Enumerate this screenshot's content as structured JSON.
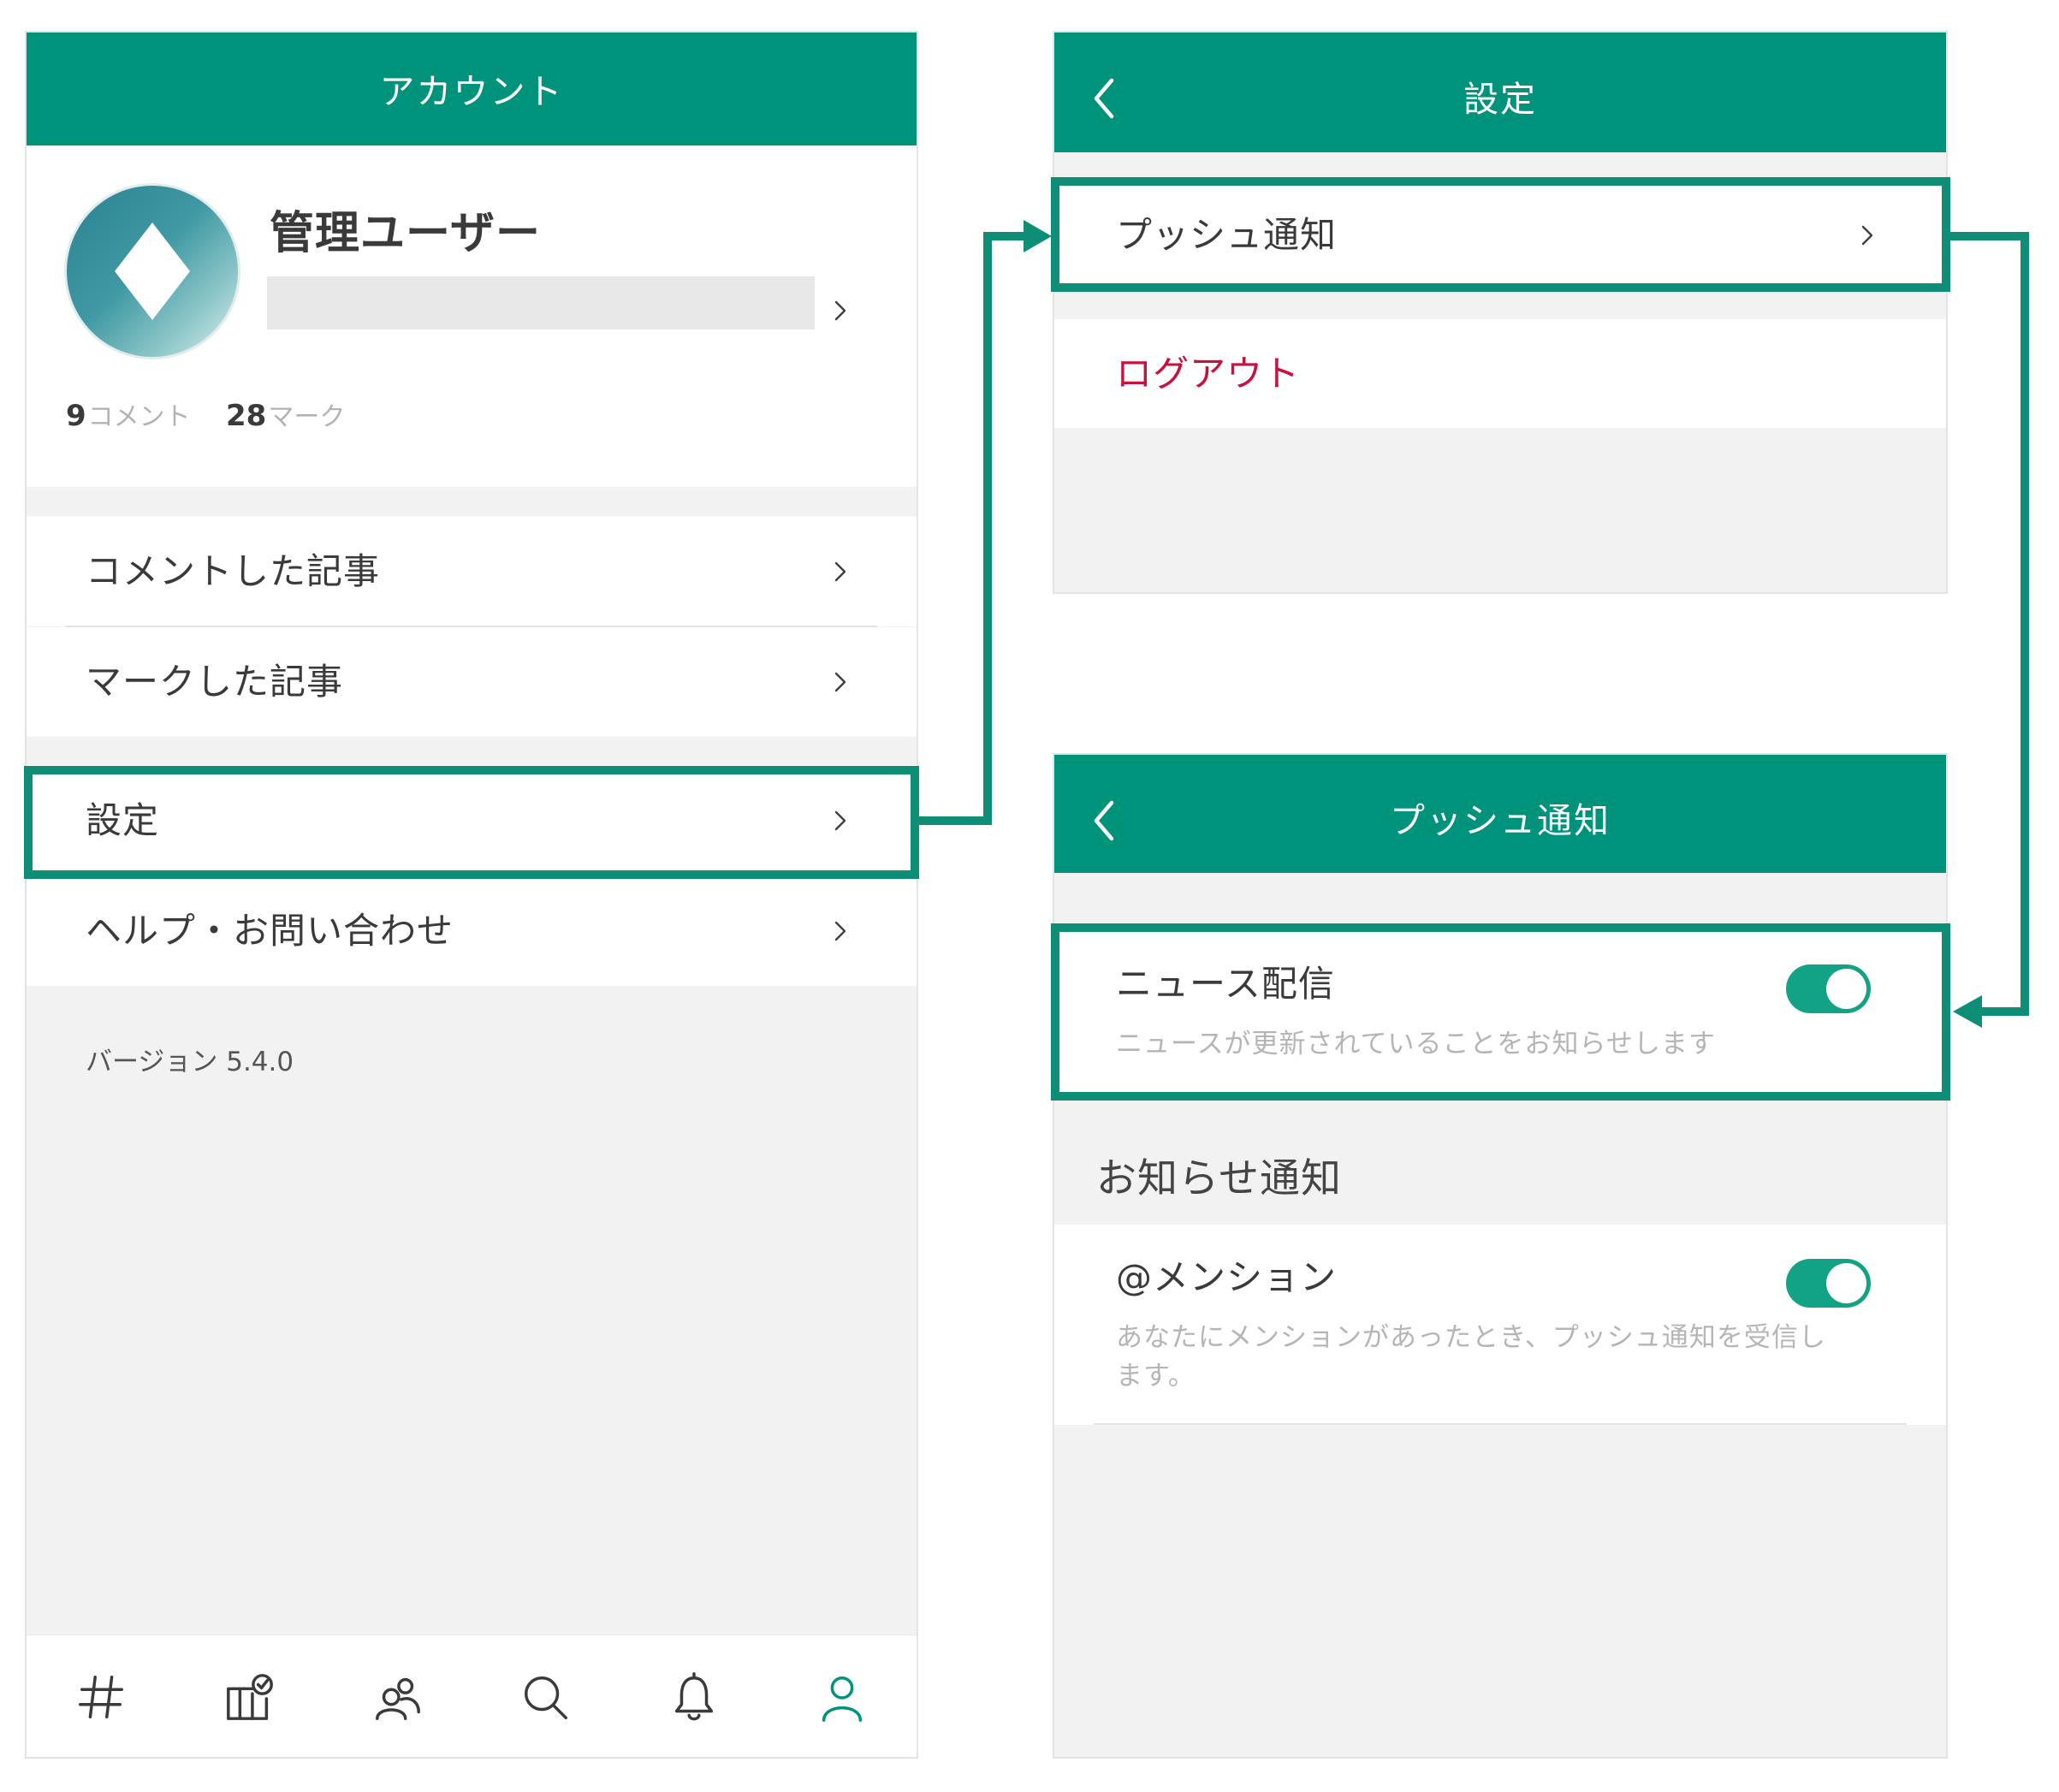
{
  "colors": {
    "brand_green": "#00937c",
    "highlight": "#0e8e77",
    "logout_red": "#c8113f",
    "toggle_on": "#12a386"
  },
  "account_screen": {
    "header": {
      "title": "アカウント"
    },
    "profile": {
      "name": "管理ユーザー",
      "avatar_icon": "diamond-avatar-icon",
      "stats": [
        {
          "count": "9",
          "label": "コメント"
        },
        {
          "count": "28",
          "label": "マーク"
        }
      ]
    },
    "menu_group_1": [
      {
        "label": "コメントした記事"
      },
      {
        "label": "マークした記事"
      }
    ],
    "menu_group_2": [
      {
        "label": "設定"
      },
      {
        "label": "ヘルプ・お問い合わせ"
      }
    ],
    "version": "バージョン 5.4.0",
    "tabbar": [
      {
        "icon": "hashtag-icon",
        "active": false
      },
      {
        "icon": "column-check-icon",
        "active": false
      },
      {
        "icon": "users-icon",
        "active": false
      },
      {
        "icon": "search-icon",
        "active": false
      },
      {
        "icon": "bell-icon",
        "active": false
      },
      {
        "icon": "user-icon",
        "active": true
      }
    ]
  },
  "settings_screen": {
    "header": {
      "title": "設定",
      "back_icon": "chevron-left-icon"
    },
    "items": [
      {
        "label": "プッシュ通知"
      }
    ],
    "logout_label": "ログアウト"
  },
  "push_screen": {
    "header": {
      "title": "プッシュ通知",
      "back_icon": "chevron-left-icon"
    },
    "news": {
      "title": "ニュース配信",
      "description": "ニュースが更新されていることをお知らせします",
      "enabled": true
    },
    "section_title": "お知らせ通知",
    "mention": {
      "title": "@メンション",
      "description": "あなたにメンションがあったとき、プッシュ通知を受信します。",
      "enabled": true
    }
  }
}
